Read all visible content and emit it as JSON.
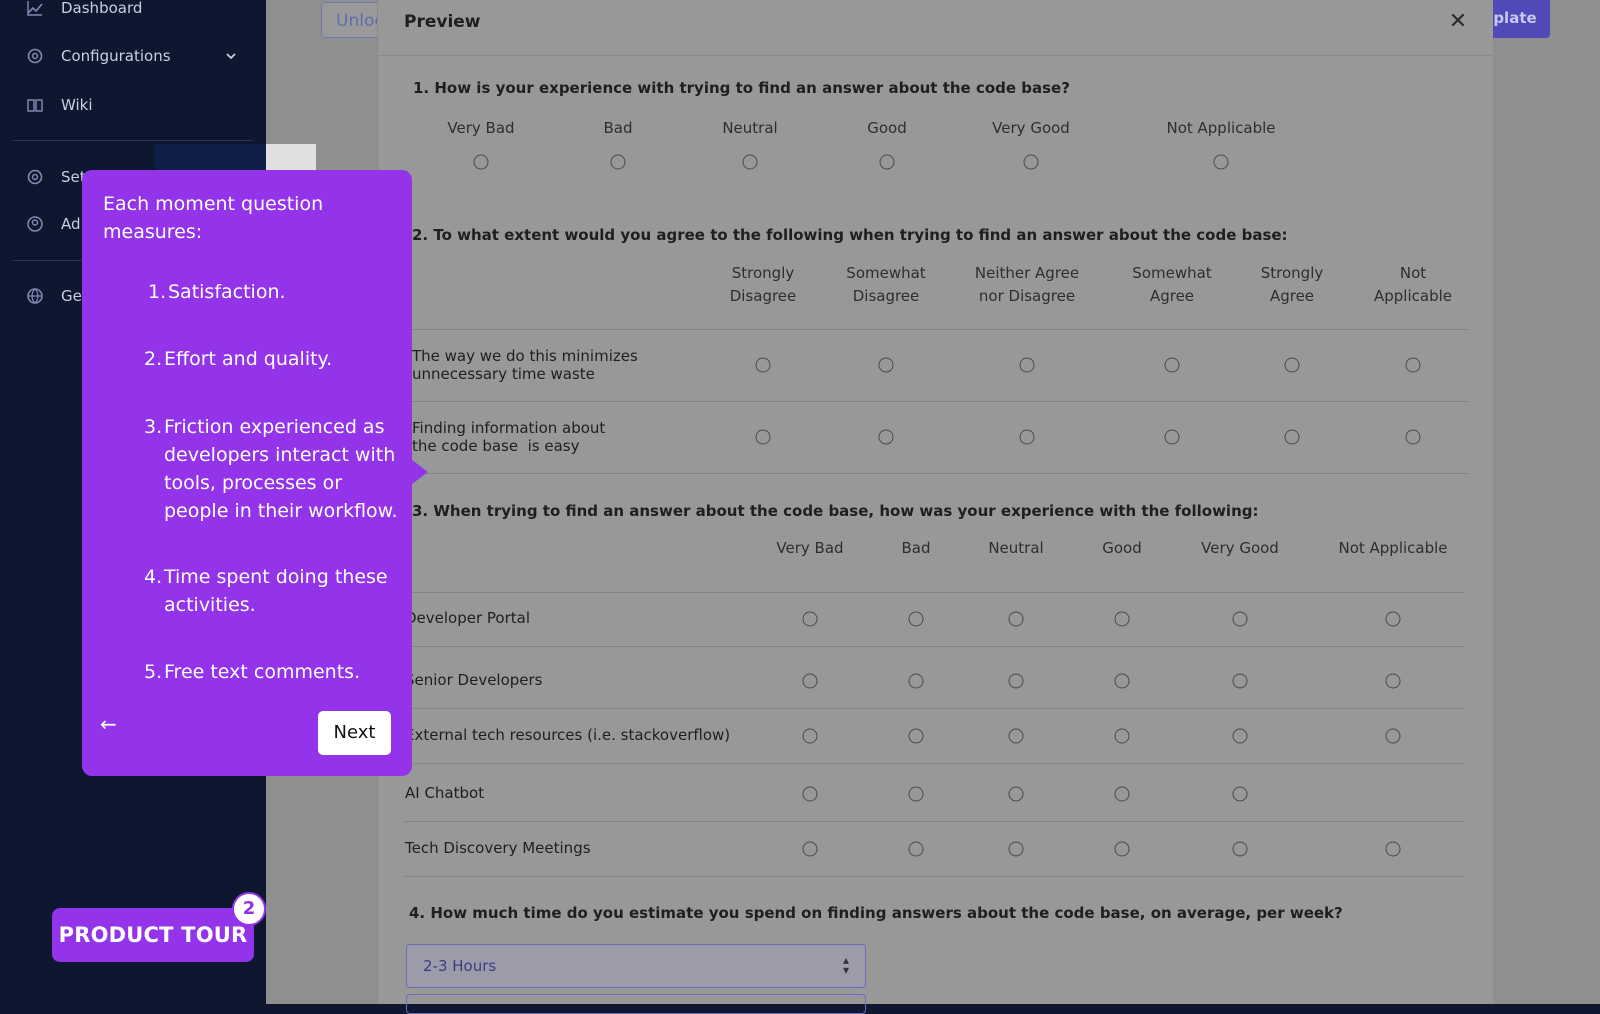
{
  "sidebar": {
    "items": [
      {
        "label": "Dashboard",
        "icon": "chart-icon"
      },
      {
        "label": "Configurations",
        "icon": "gear-icon"
      },
      {
        "label": "Wiki",
        "icon": "book-icon"
      },
      {
        "label": "Set",
        "icon": "gear-icon"
      },
      {
        "label": "Ad",
        "icon": "user-circle-icon"
      },
      {
        "label": "Ge",
        "icon": "globe-icon"
      }
    ]
  },
  "background": {
    "unlock_btn": "Unloc",
    "template_btn": "plate"
  },
  "modal": {
    "title": "Preview",
    "close": "✕",
    "q1": {
      "text": "1. How is your experience with trying to find an answer about the code base?",
      "options": [
        "Very Bad",
        "Bad",
        "Neutral",
        "Good",
        "Very Good",
        "Not Applicable"
      ]
    },
    "q2": {
      "text": "2. To what extent would you agree to the following when trying to find an answer about the code base:",
      "options": [
        "Strongly\nDisagree",
        "Somewhat\nDisagree",
        "Neither Agree\nnor Disagree",
        "Somewhat\nAgree",
        "Strongly\nAgree",
        "Not\nApplicable"
      ],
      "rows": [
        "The way we do this minimizes\nunnecessary time waste",
        "Finding information about\nthe code base  is easy"
      ]
    },
    "q3": {
      "text": "3. When trying to find an answer about the code base, how was your experience with the following:",
      "options": [
        "Very Bad",
        "Bad",
        "Neutral",
        "Good",
        "Very Good",
        "Not Applicable"
      ],
      "rows": [
        "Developer Portal",
        "Senior Developers",
        "External tech resources (i.e. stackoverflow)",
        "AI Chatbot",
        "Tech Discovery Meetings"
      ]
    },
    "q4": {
      "text": "4. How much time do you estimate you spend on finding answers about the code base, on average, per week?",
      "selected": "2-3 Hours"
    }
  },
  "tooltip": {
    "heading": "Each moment question measures:",
    "items": [
      {
        "num": "1.",
        "text": "Satisfaction."
      },
      {
        "num": "2.",
        "text": "Effort and quality."
      },
      {
        "num": "3.",
        "text": "Friction experienced as developers interact with tools, processes or people in their workflow."
      },
      {
        "num": "4.",
        "text": "Time spent doing these activities."
      },
      {
        "num": "5.",
        "text": "Free text comments."
      }
    ],
    "back": "←",
    "next": "Next"
  },
  "tour": {
    "label": "PRODUCT TOUR",
    "badge": "2"
  }
}
